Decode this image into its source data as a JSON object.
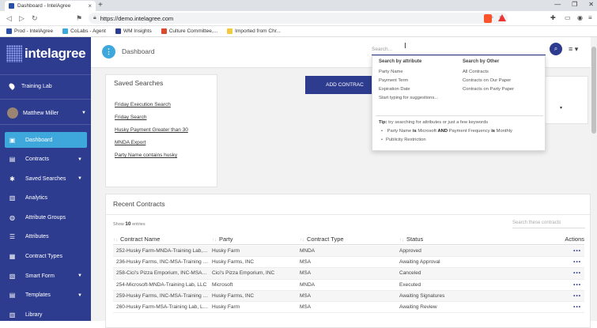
{
  "browser": {
    "tab_title": "Dashboard - IntelAgree",
    "tab_close": "×",
    "new_tab": "+",
    "url": "https://demo.intelagree.com",
    "window_controls": [
      "—",
      "❐",
      "✕"
    ]
  },
  "bookmarks": [
    {
      "label": "Prod - IntelAgree",
      "color": "#2a4fa8"
    },
    {
      "label": "CoLabs - Agent",
      "color": "#3ea8dd"
    },
    {
      "label": "WM Insights",
      "color": "#2e3c8f"
    },
    {
      "label": "Culture Committee,...",
      "color": "#d94a2e"
    },
    {
      "label": "Imported from Chr...",
      "color": "#f5c842"
    }
  ],
  "sidebar": {
    "logo": "intelagree",
    "lab": "Training Lab",
    "user": "Matthew Miller",
    "items": [
      {
        "label": "Dashboard",
        "icon": "▣",
        "active": true,
        "caret": false
      },
      {
        "label": "Contracts",
        "icon": "▤",
        "active": false,
        "caret": true
      },
      {
        "label": "Saved Searches",
        "icon": "✱",
        "active": false,
        "caret": true
      },
      {
        "label": "Analytics",
        "icon": "▥",
        "active": false,
        "caret": false
      },
      {
        "label": "Attribute Groups",
        "icon": "◍",
        "active": false,
        "caret": false
      },
      {
        "label": "Attributes",
        "icon": "☰",
        "active": false,
        "caret": false
      },
      {
        "label": "Contract Types",
        "icon": "▦",
        "active": false,
        "caret": false
      },
      {
        "label": "Smart Form",
        "icon": "▧",
        "active": false,
        "caret": true
      },
      {
        "label": "Templates",
        "icon": "▤",
        "active": false,
        "caret": true
      },
      {
        "label": "Library",
        "icon": "▥",
        "active": false,
        "caret": false
      }
    ]
  },
  "header": {
    "title": "Dashboard",
    "search_placeholder": "Search..."
  },
  "saved_searches": {
    "title": "Saved Searches",
    "items": [
      "Friday Execution Search",
      "Friday Search",
      "Husky Payment Greater than 30",
      "MNDA Export",
      "Party Name contains husky"
    ]
  },
  "add_contract_label": "ADD CONTRAC",
  "search_dropdown": {
    "by_attribute_title": "Search by attribute",
    "by_attribute": [
      "Party Name",
      "Payment Term",
      "Expiration Date",
      "Start typing for suggestions..."
    ],
    "by_other_title": "Search by Other",
    "by_other": [
      "All Contracts",
      "Contracts on Our Paper",
      "Contracts on Party Paper"
    ],
    "tip_label": "Tip:",
    "tip_text": "try searching for attributes or just a few keywords",
    "example1": {
      "a": "Party Name",
      "is1": "is",
      "b": "Microsoft",
      "and": "AND",
      "c": "Payment Frequency",
      "is2": "is",
      "d": "Monthly"
    },
    "example2": "Publicity Restriction"
  },
  "recent_contracts": {
    "title": "Recent Contracts",
    "show_prefix": "Show",
    "show_count": "10",
    "show_suffix": "entries",
    "search_placeholder": "Search these contracts",
    "columns": [
      "Contract Name",
      "Party",
      "Contract Type",
      "Status",
      "Actions"
    ],
    "rows": [
      {
        "name": "252-Husky Farm-MNDA-Training Lab, LLC",
        "party": "Husky Farm",
        "type": "MNDA",
        "status": "Approved"
      },
      {
        "name": "236-Husky Farms, INC-MSA-Training Lab,...",
        "party": "Husky Farms, INC",
        "type": "MSA",
        "status": "Awaiting Approval"
      },
      {
        "name": "258-Cici's Pizza Emporium, INC-MSA-Traini...",
        "party": "Cici's Pizza Emporium, INC",
        "type": "MSA",
        "status": "Canceled"
      },
      {
        "name": "254-Microsoft-MNDA-Training Lab, LLC",
        "party": "Microsoft",
        "type": "MNDA",
        "status": "Executed"
      },
      {
        "name": "259-Husky Farms, INC-MSA-Training Lab,...",
        "party": "Husky Farms, INC",
        "type": "MSA",
        "status": "Awaiting Signatures"
      },
      {
        "name": "260-Husky Farm-MSA-Training Lab, LLC",
        "party": "Husky Farm",
        "type": "MSA",
        "status": "Awaiting Review"
      }
    ],
    "action_glyph": "•••"
  }
}
